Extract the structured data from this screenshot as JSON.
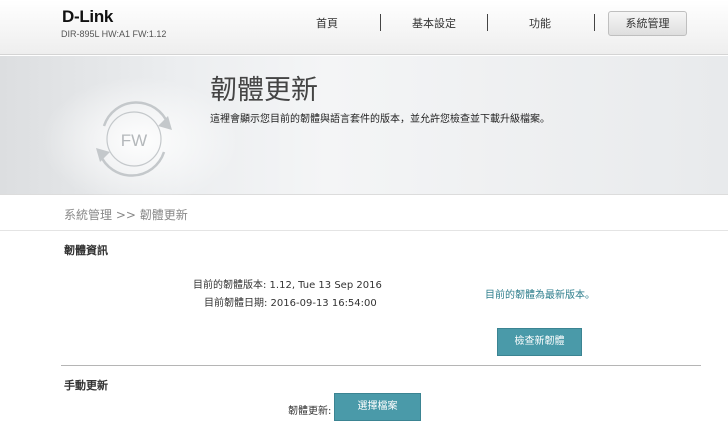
{
  "brand": {
    "logo": "D-Link",
    "model_info": "DIR-895L HW:A1 FW:1.12"
  },
  "nav": {
    "items": [
      "首頁",
      "基本設定",
      "功能"
    ],
    "active": "系統管理"
  },
  "banner": {
    "title": "韌體更新",
    "description": "這裡會顯示您目前的韌體與語言套件的版本，並允許您檢查並下載升級檔案。",
    "icon_text": "FW"
  },
  "breadcrumb": "系統管理 >> 韌體更新",
  "firmware_info": {
    "heading": "韌體資訊",
    "version_line": "目前的韌體版本: 1.12, Tue 13 Sep 2016",
    "date_line": "目前韌體日期: 2016-09-13 16:54:00",
    "status": "目前的韌體為最新版本。",
    "check_button": "檢查新韌體"
  },
  "manual_upgrade": {
    "heading": "手動更新",
    "label": "韌體更新:",
    "choose_button": "選擇檔案"
  },
  "colors": {
    "accent": "#4a9aa9",
    "status_text": "#2d7e8c"
  }
}
